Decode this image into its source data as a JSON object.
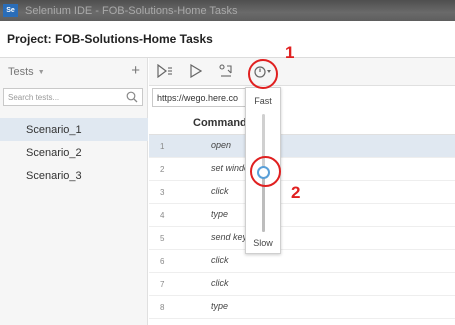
{
  "window": {
    "app_logo_text": "Se",
    "title": "Selenium IDE - FOB-Solutions-Home Tasks"
  },
  "project": {
    "title": "Project:  FOB-Solutions-Home Tasks"
  },
  "tests_panel": {
    "header_label": "Tests",
    "dropdown_icon": "triangle-down",
    "add_icon": "+",
    "search_placeholder": "Search tests...",
    "tests": [
      "Scenario_1",
      "Scenario_2",
      "Scenario_3"
    ],
    "selected_test": "Scenario_1"
  },
  "toolbar": {
    "buttons": [
      "run-all-icon",
      "run-current-icon",
      "step-over-icon",
      "speed-icon"
    ]
  },
  "url_bar": {
    "value": "https://wego.here.co"
  },
  "command_table": {
    "header": "Command",
    "rows": [
      {
        "num": "1",
        "command": "open"
      },
      {
        "num": "2",
        "command": "set window"
      },
      {
        "num": "3",
        "command": "click"
      },
      {
        "num": "4",
        "command": "type"
      },
      {
        "num": "5",
        "command": "send keys"
      },
      {
        "num": "6",
        "command": "click"
      },
      {
        "num": "7",
        "command": "click"
      },
      {
        "num": "8",
        "command": "type"
      }
    ],
    "selected_row": 1
  },
  "speed_popover": {
    "fast_label": "Fast",
    "slow_label": "Slow",
    "speed_level": 0.5
  },
  "annotations": {
    "label_1": "1",
    "label_2": "2",
    "color": "#e02020"
  }
}
